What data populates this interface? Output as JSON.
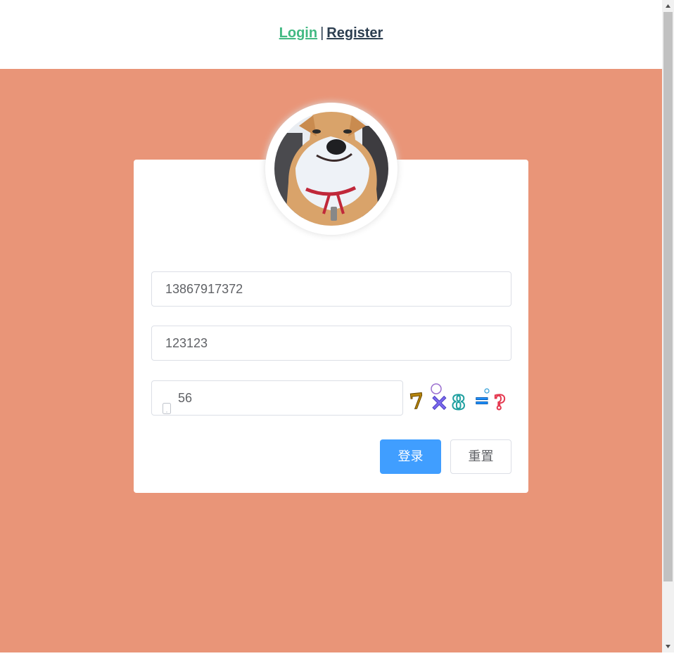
{
  "nav": {
    "login_label": "Login",
    "separator": "|",
    "register_label": "Register"
  },
  "form": {
    "phone_value": "13867917372",
    "password_value": "123123",
    "captcha_value": "56",
    "captcha_image": {
      "glyphs": [
        "7",
        "×",
        "8",
        "=",
        "?"
      ],
      "colors": [
        "#b8860b",
        "#7b68ee",
        "#20b2aa",
        "#1e90ff",
        "#e53950"
      ]
    }
  },
  "buttons": {
    "login_label": "登录",
    "reset_label": "重置"
  },
  "icons": {
    "captcha_prefix": "mobile-phone-icon"
  },
  "colors": {
    "background": "#e99578",
    "link_active": "#42b983",
    "link": "#2c3e50",
    "primary": "#409eff"
  }
}
